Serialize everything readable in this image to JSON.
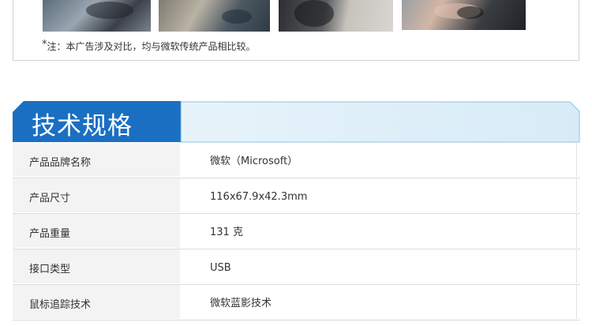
{
  "footnote": {
    "star": "*",
    "text": "注：本广告涉及对比，均与微软传统产品相比较。"
  },
  "spec": {
    "title": "技术规格",
    "rows": [
      {
        "key": "产品品牌名称",
        "value": "微软（Microsoft）"
      },
      {
        "key": "产品尺寸",
        "value": "116x67.9x42.3mm"
      },
      {
        "key": "产品重量",
        "value": "131 克"
      },
      {
        "key": "接口类型",
        "value": "USB"
      },
      {
        "key": "鼠标追踪技术",
        "value": "微软蓝影技术"
      }
    ]
  },
  "colors": {
    "title_band": "#1a6fc2",
    "header_light": "#ddeef8",
    "key_bg": "#f3f3f3"
  }
}
